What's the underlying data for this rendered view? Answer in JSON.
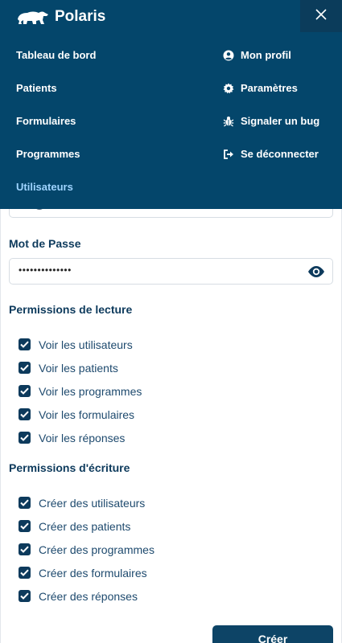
{
  "brand": {
    "name": "Polaris"
  },
  "nav": {
    "left": [
      {
        "label": "Tableau de bord"
      },
      {
        "label": "Patients"
      },
      {
        "label": "Formulaires"
      },
      {
        "label": "Programmes"
      },
      {
        "label": "Utilisateurs"
      }
    ],
    "right": [
      {
        "label": "Mon profil",
        "icon": "user-circle-icon"
      },
      {
        "label": "Paramètres",
        "icon": "gear-icon"
      },
      {
        "label": "Signaler un bug",
        "icon": "bug-icon"
      },
      {
        "label": "Se déconnecter",
        "icon": "logout-icon"
      }
    ]
  },
  "form": {
    "password_label": "Mot de Passe",
    "password_value": "••••••••••••••",
    "read_title": "Permissions de lecture",
    "read_permissions": [
      "Voir les utilisateurs",
      "Voir les patients",
      "Voir les programmes",
      "Voir les formulaires",
      "Voir les réponses"
    ],
    "write_title": "Permissions d'écriture",
    "write_permissions": [
      "Créer des utilisateurs",
      "Créer des patients",
      "Créer des programmes",
      "Créer des formulaires",
      "Créer des réponses"
    ],
    "submit_label": "Créer"
  },
  "colors": {
    "navbar": "#04466b",
    "accent": "#0d3a5c",
    "active_nav": "#9fd4ff"
  }
}
